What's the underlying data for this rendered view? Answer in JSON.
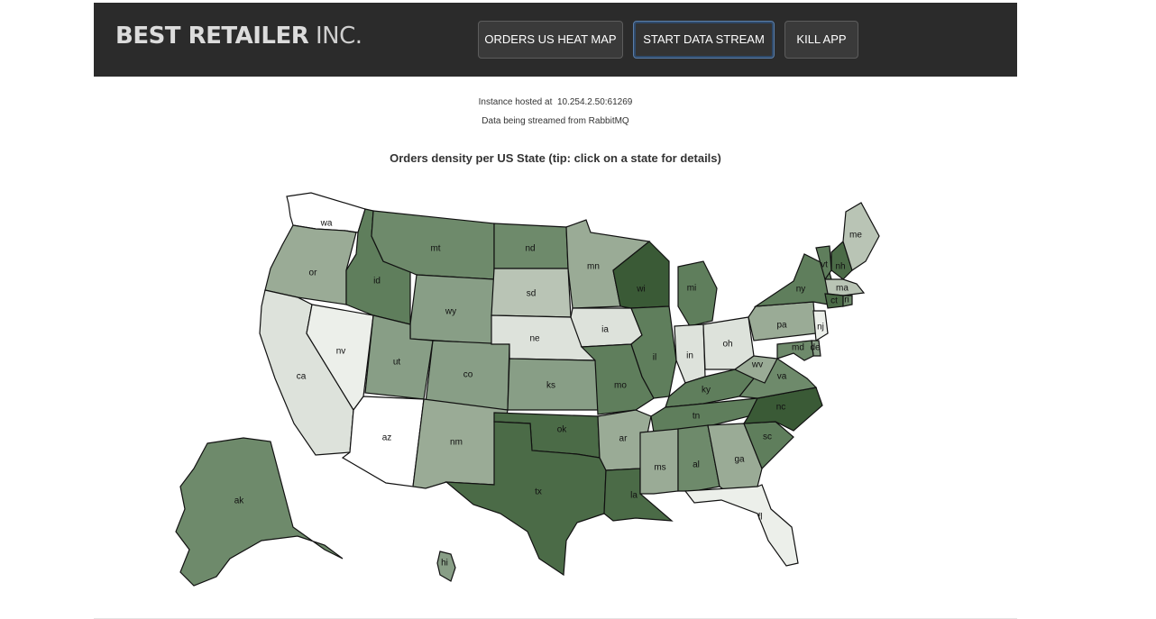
{
  "header": {
    "brand_bold": "BEST RETAILER",
    "brand_light": "INC.",
    "buttons": [
      {
        "label": "ORDERS US HEAT MAP"
      },
      {
        "label": "START DATA STREAM"
      },
      {
        "label": "KILL APP"
      }
    ]
  },
  "info": {
    "hosted_prefix": "Instance hosted at",
    "hosted_address": "10.254.2.50:61269",
    "stream_text": "Data being streamed from RabbitMQ"
  },
  "map": {
    "title": "Orders density per US State (tip: click on a state for details)",
    "colors": {
      "d0": "#ffffff",
      "d1": "#ecefea",
      "d2": "#dde2db",
      "d3": "#b9c4b5",
      "d4": "#9aab96",
      "d5": "#889e86",
      "d6": "#6e8a6b",
      "d7": "#5f7e5c",
      "d8": "#4b6b47",
      "d9": "#3a5a36"
    },
    "states": [
      {
        "abbr": "wa",
        "density": "d0"
      },
      {
        "abbr": "or",
        "density": "d4"
      },
      {
        "abbr": "ca",
        "density": "d2"
      },
      {
        "abbr": "nv",
        "density": "d1"
      },
      {
        "abbr": "id",
        "density": "d7"
      },
      {
        "abbr": "mt",
        "density": "d6"
      },
      {
        "abbr": "wy",
        "density": "d5"
      },
      {
        "abbr": "ut",
        "density": "d5"
      },
      {
        "abbr": "az",
        "density": "d0"
      },
      {
        "abbr": "co",
        "density": "d5"
      },
      {
        "abbr": "nm",
        "density": "d4"
      },
      {
        "abbr": "nd",
        "density": "d6"
      },
      {
        "abbr": "sd",
        "density": "d3"
      },
      {
        "abbr": "ne",
        "density": "d2"
      },
      {
        "abbr": "ks",
        "density": "d5"
      },
      {
        "abbr": "ok",
        "density": "d8"
      },
      {
        "abbr": "tx",
        "density": "d8"
      },
      {
        "abbr": "mn",
        "density": "d4"
      },
      {
        "abbr": "ia",
        "density": "d2"
      },
      {
        "abbr": "mo",
        "density": "d7"
      },
      {
        "abbr": "ar",
        "density": "d4"
      },
      {
        "abbr": "la",
        "density": "d8"
      },
      {
        "abbr": "wi",
        "density": "d9"
      },
      {
        "abbr": "il",
        "density": "d7"
      },
      {
        "abbr": "mi",
        "density": "d7"
      },
      {
        "abbr": "in",
        "density": "d2"
      },
      {
        "abbr": "oh",
        "density": "d2"
      },
      {
        "abbr": "ky",
        "density": "d7"
      },
      {
        "abbr": "tn",
        "density": "d7"
      },
      {
        "abbr": "ms",
        "density": "d4"
      },
      {
        "abbr": "al",
        "density": "d6"
      },
      {
        "abbr": "ga",
        "density": "d4"
      },
      {
        "abbr": "fl",
        "density": "d1"
      },
      {
        "abbr": "sc",
        "density": "d7"
      },
      {
        "abbr": "nc",
        "density": "d9"
      },
      {
        "abbr": "va",
        "density": "d6"
      },
      {
        "abbr": "wv",
        "density": "d4"
      },
      {
        "abbr": "pa",
        "density": "d4"
      },
      {
        "abbr": "ny",
        "density": "d7"
      },
      {
        "abbr": "vt",
        "density": "d7"
      },
      {
        "abbr": "nh",
        "density": "d8"
      },
      {
        "abbr": "me",
        "density": "d3"
      },
      {
        "abbr": "ma",
        "density": "d3"
      },
      {
        "abbr": "ct",
        "density": "d8"
      },
      {
        "abbr": "ri",
        "density": "d6"
      },
      {
        "abbr": "nj",
        "density": "d1"
      },
      {
        "abbr": "de",
        "density": "d5"
      },
      {
        "abbr": "md",
        "density": "d6"
      },
      {
        "abbr": "ak",
        "density": "d6"
      },
      {
        "abbr": "hi",
        "density": "d5"
      }
    ]
  }
}
